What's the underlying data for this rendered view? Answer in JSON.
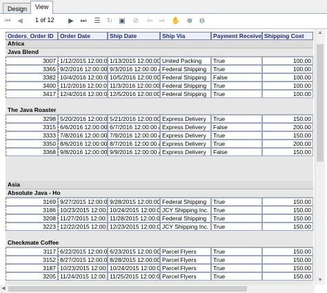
{
  "tabs": [
    {
      "label": "Design",
      "active": false
    },
    {
      "label": "View",
      "active": true
    }
  ],
  "toolbar": {
    "page_label": "1 of 12",
    "icons": [
      "first-page-icon",
      "prev-page-icon",
      "next-page-icon",
      "last-page-icon",
      "toc-icon",
      "refresh-icon",
      "print-icon",
      "stop-icon",
      "back-icon",
      "forward-icon",
      "pan-icon",
      "zoom-in-icon",
      "zoom-out-icon"
    ]
  },
  "columns": [
    "Orders_Order ID",
    "Order Date",
    "Ship Date",
    "Ship Via",
    "Payment Received",
    "Shipping Cost"
  ],
  "regions": [
    {
      "name": "Africa",
      "customers": [
        {
          "name": "Java Blend",
          "rows": [
            [
              "3007",
              "1/12/2015 12:00:00",
              "1/13/2015 12:00:00 A",
              "United Packing",
              "True",
              "100.00"
            ],
            [
              "3365",
              "9/2/2016 12:00:00 A",
              "9/3/2016 12:00:00 A",
              "Federal Shipping",
              "True",
              "100.00"
            ],
            [
              "3382",
              "10/4/2016 12:00:00",
              "10/5/2016 12:00:00 A",
              "Federal Shipping",
              "False",
              "100.00"
            ],
            [
              "3400",
              "11/2/2016 12:00:00",
              "11/3/2016 12:00:00 A",
              "Federal Shipping",
              "True",
              "100.00"
            ],
            [
              "3417",
              "12/4/2016 12:00:00",
              "12/5/2016 12:00:00 A",
              "Federal Shipping",
              "True",
              "100.00"
            ]
          ]
        },
        {
          "name": "The Java Roaster",
          "rows": [
            [
              "3298",
              "5/20/2016 12:00:00",
              "5/21/2016 12:00:00 A",
              "Express Delivery",
              "True",
              "150.00"
            ],
            [
              "3315",
              "6/6/2016 12:00:00 A",
              "6/7/2016 12:00:00 A",
              "Express Delivery",
              "False",
              "200.00"
            ],
            [
              "3333",
              "7/8/2016 12:00:00 A",
              "7/9/2016 12:00:00 A",
              "Express Delivery",
              "True",
              "150.00"
            ],
            [
              "3350",
              "8/6/2016 12:00:00 A",
              "8/7/2016 12:00:00 A",
              "Express Delivery",
              "True",
              "200.00"
            ],
            [
              "3368",
              "9/8/2016 12:00:00 A",
              "9/9/2016 12:00:00 A",
              "Express Delivery",
              "False",
              "150.00"
            ]
          ]
        }
      ]
    },
    {
      "name": "Asia",
      "customers": [
        {
          "name": "Absolute Java - Ho",
          "rows": [
            [
              "3169",
              "9/27/2015 12:00:00",
              "9/28/2015 12:00:00 A",
              "Federal Shipping",
              "True",
              "150.00"
            ],
            [
              "3186",
              "10/23/2015 12:00:0",
              "10/24/2015 12:00:00",
              "JCY Shipping Inc.",
              "True",
              "150.00"
            ],
            [
              "3208",
              "11/27/2015 12:00:0",
              "11/28/2015 12:00:00",
              "Federal Shipping",
              "True",
              "150.00"
            ],
            [
              "3223",
              "12/22/2015 12:00:0",
              "12/23/2015 12:00:00",
              "JCY Shipping Inc.",
              "True",
              "150.00"
            ]
          ]
        },
        {
          "name": "Checkmate Coffee",
          "rows": [
            [
              "3117",
              "6/22/2015 12:00:00",
              "6/23/2015 12:00:00 A",
              "Parcel Flyers",
              "True",
              "150.00"
            ],
            [
              "3152",
              "8/27/2015 12:00:00",
              "8/28/2015 12:00:00 A",
              "Parcel Flyers",
              "True",
              "150.00"
            ],
            [
              "3187",
              "10/23/2015 12:00:0",
              "10/24/2015 12:00:00",
              "Parcel Flyers",
              "True",
              "150.00"
            ],
            [
              "3205",
              "11/24/2015 12:00:0",
              "11/25/2015 12:00:00",
              "Parcel Flyers",
              "True",
              "150.00"
            ]
          ]
        }
      ]
    }
  ]
}
